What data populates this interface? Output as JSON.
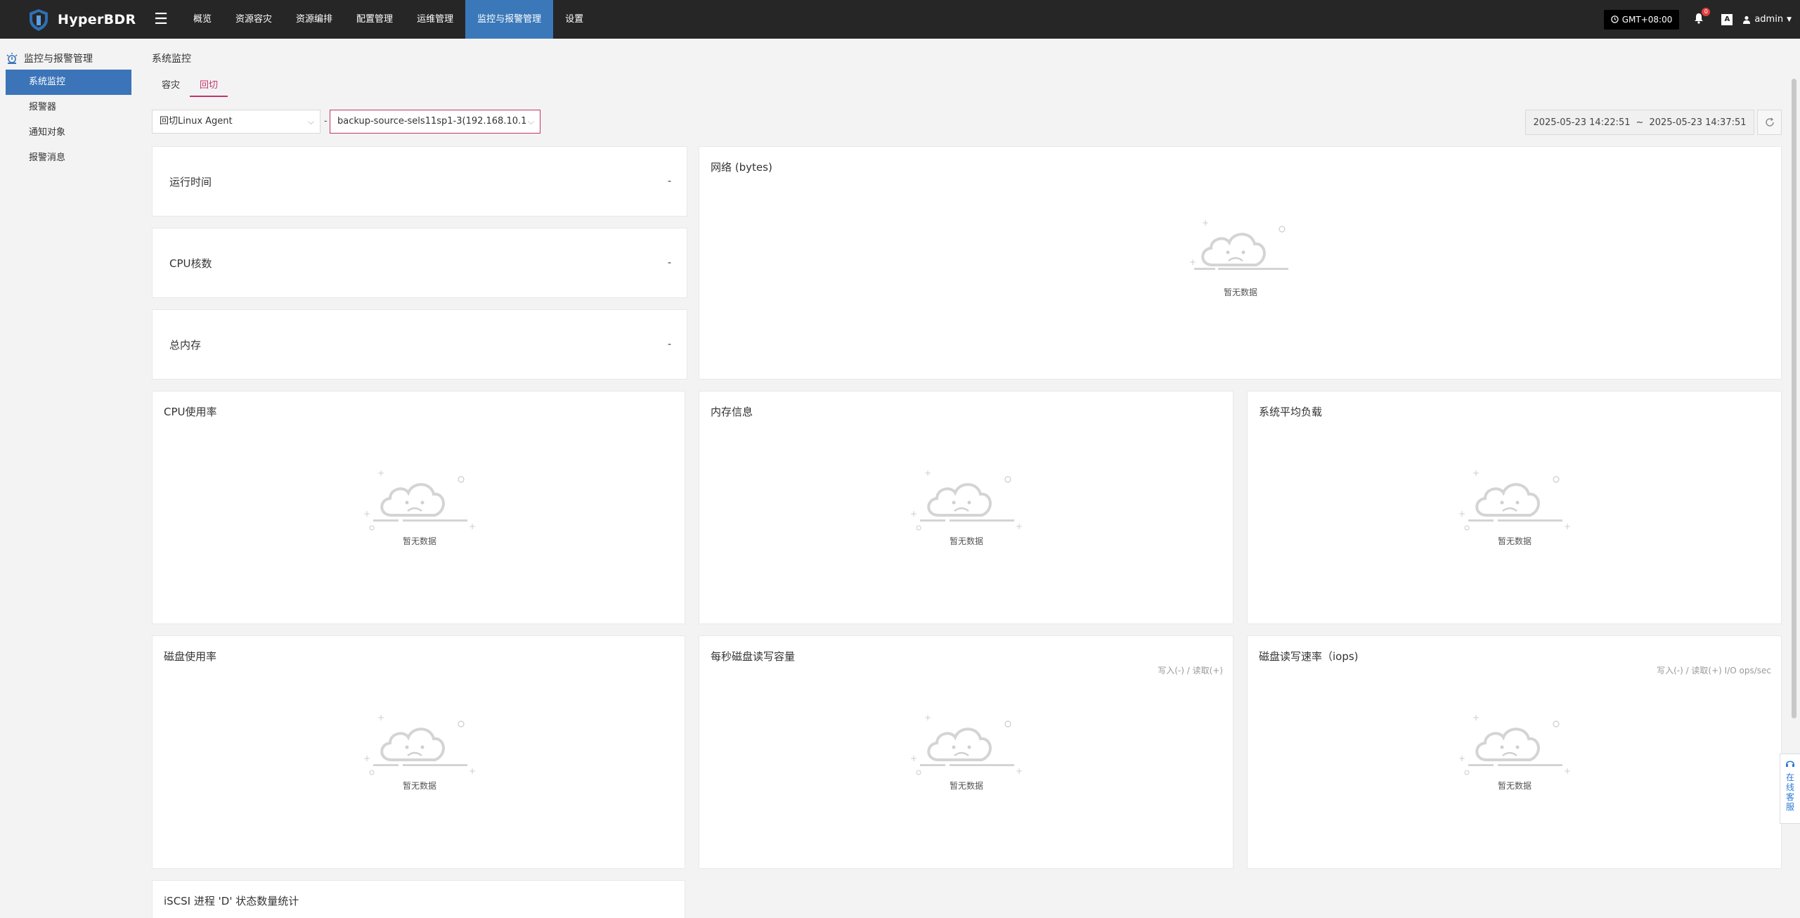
{
  "app": {
    "name": "HyperBDR"
  },
  "nav": {
    "items": [
      "概览",
      "资源容灾",
      "资源编排",
      "配置管理",
      "运维管理",
      "监控与报警管理",
      "设置"
    ],
    "active_index": 5
  },
  "topbar": {
    "timezone": "GMT+08:00",
    "notification_count": "0",
    "lang_label": "A",
    "user": "admin"
  },
  "sidebar": {
    "title": "监控与报警管理",
    "items": [
      "系统监控",
      "报警器",
      "通知对象",
      "报警消息"
    ],
    "active_index": 0
  },
  "page": {
    "title": "系统监控",
    "tabs": [
      "容灾",
      "回切"
    ],
    "active_tab": 1
  },
  "filters": {
    "agent_type": "回切Linux Agent",
    "separator": "-",
    "host": "backup-source-sels11sp1-3(192.168.10.1",
    "date_from": "2025-05-23 14:22:51",
    "date_sep": "~",
    "date_to": "2025-05-23 14:37:51"
  },
  "stats": {
    "uptime_label": "运行时间",
    "uptime_value": "-",
    "cpu_cores_label": "CPU核数",
    "cpu_cores_value": "-",
    "memory_label": "总内存",
    "memory_value": "-"
  },
  "panels": {
    "network": "网络 (bytes)",
    "cpu_usage": "CPU使用率",
    "memory_info": "内存信息",
    "load_avg": "系统平均负载",
    "disk_usage": "磁盘使用率",
    "disk_rw_capacity": "每秒磁盘读写容量",
    "disk_rw_capacity_sub": "写入(-) / 读取(+)",
    "disk_iops": "磁盘读写速率（iops)",
    "disk_iops_sub": "写入(-) / 读取(+) I/O ops/sec",
    "iscsi": "iSCSI 进程 'D' 状态数量统计"
  },
  "empty_text": "暂无数据",
  "help": {
    "label": "在线客服",
    "chars": [
      "在",
      "线",
      "客",
      "服"
    ]
  },
  "colors": {
    "topbar_bg": "#262626",
    "nav_active": "#3a78b9",
    "sidebar_active": "#3b74b8",
    "accent": "#c0366b"
  }
}
